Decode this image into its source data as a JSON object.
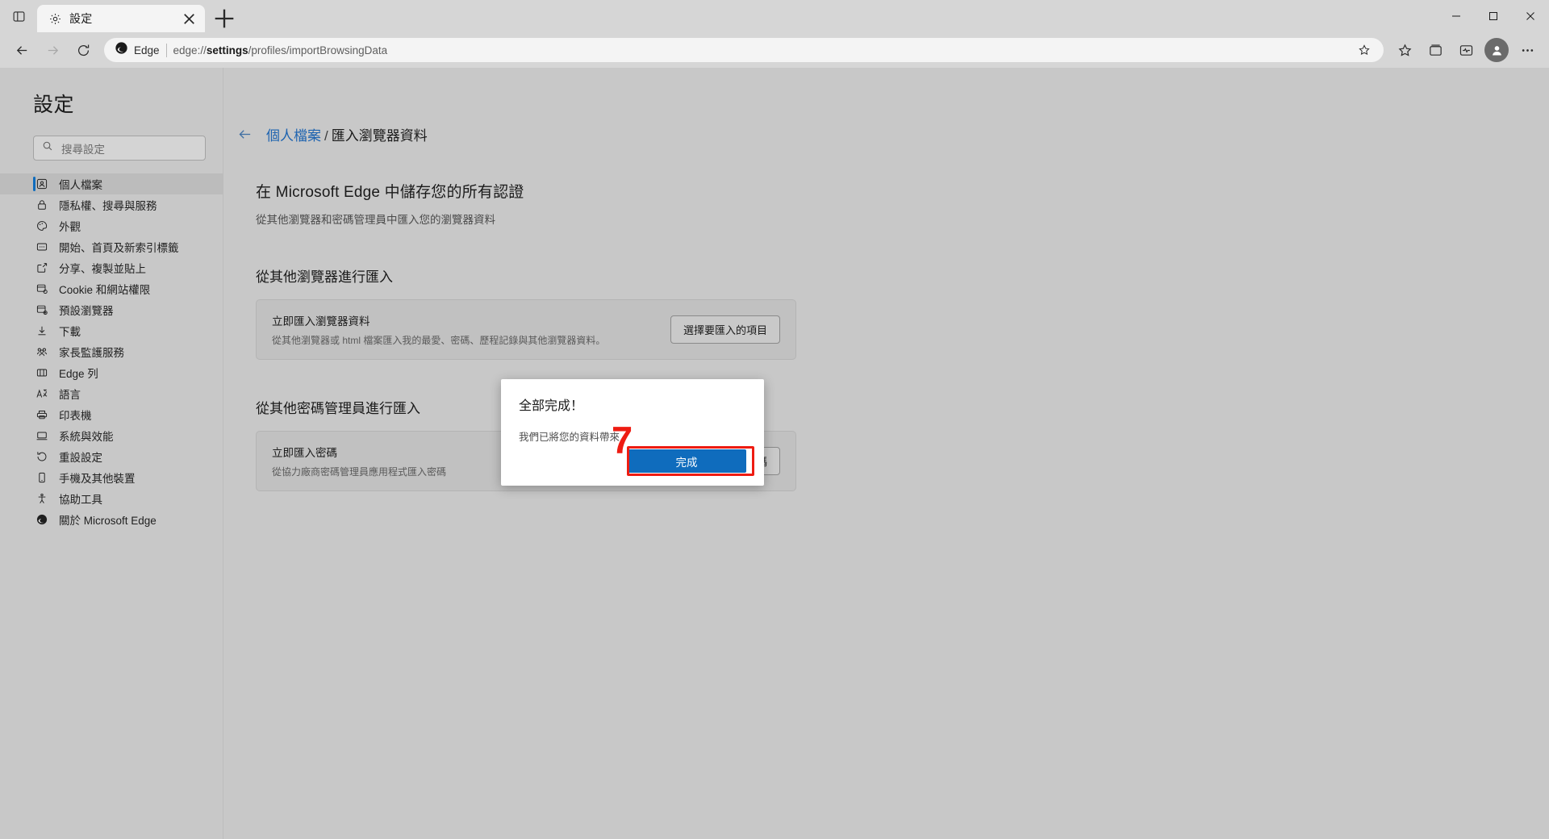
{
  "window": {
    "tab_title": "設定",
    "minimize_label": "最小化",
    "maximize_label": "最大化",
    "close_label": "關閉",
    "new_tab_label": "新索引標籤",
    "tab_actions_label": "索引標籤動作"
  },
  "toolbar": {
    "back_label": "上一頁",
    "forward_label": "下一頁",
    "refresh_label": "重新整理",
    "brand": "Edge",
    "url_prefix": "edge://",
    "url_bold": "settings",
    "url_suffix": "/profiles/importBrowsingData",
    "url_full": "edge://settings/profiles/importBrowsingData",
    "favorite_label": "新增至我的最愛",
    "favorites_label": "我的最愛",
    "collections_label": "集錦",
    "browser_essentials_label": "瀏覽器必備項目",
    "profile_label": "設定檔",
    "settings_more_label": "設定及其他"
  },
  "sidebar": {
    "title": "設定",
    "search_placeholder": "搜尋設定",
    "items": [
      {
        "label": "個人檔案",
        "icon": "profile-icon",
        "active": true
      },
      {
        "label": "隱私權、搜尋與服務",
        "icon": "lock-icon",
        "active": false
      },
      {
        "label": "外觀",
        "icon": "palette-icon",
        "active": false
      },
      {
        "label": "開始、首頁及新索引標籤",
        "icon": "home-icon",
        "active": false
      },
      {
        "label": "分享、複製並貼上",
        "icon": "share-icon",
        "active": false
      },
      {
        "label": "Cookie 和網站權限",
        "icon": "cookie-icon",
        "active": false
      },
      {
        "label": "預設瀏覽器",
        "icon": "default-browser-icon",
        "active": false
      },
      {
        "label": "下載",
        "icon": "download-icon",
        "active": false
      },
      {
        "label": "家長監護服務",
        "icon": "family-icon",
        "active": false
      },
      {
        "label": "Edge 列",
        "icon": "edge-bar-icon",
        "active": false
      },
      {
        "label": "語言",
        "icon": "language-icon",
        "active": false
      },
      {
        "label": "印表機",
        "icon": "printer-icon",
        "active": false
      },
      {
        "label": "系統與效能",
        "icon": "system-icon",
        "active": false
      },
      {
        "label": "重設設定",
        "icon": "reset-icon",
        "active": false
      },
      {
        "label": "手機及其他裝置",
        "icon": "phone-icon",
        "active": false
      },
      {
        "label": "協助工具",
        "icon": "accessibility-icon",
        "active": false
      },
      {
        "label": "關於 Microsoft Edge",
        "icon": "edge-logo-icon",
        "active": false
      }
    ]
  },
  "main": {
    "breadcrumb_parent": "個人檔案",
    "breadcrumb_separator": "/",
    "breadcrumb_current": "匯入瀏覽器資料",
    "heading": "在 Microsoft Edge 中儲存您的所有認證",
    "subheading": "從其他瀏覽器和密碼管理員中匯入您的瀏覽器資料",
    "section_browsers": {
      "heading": "從其他瀏覽器進行匯入",
      "card_title": "立即匯入瀏覽器資料",
      "card_desc": "從其他瀏覽器或 html 檔案匯入我的最愛、密碼、歷程記錄與其他瀏覽器資料。",
      "button": "選擇要匯入的項目"
    },
    "section_managers": {
      "heading": "從其他密碼管理員進行匯入",
      "card_title": "立即匯入密碼",
      "card_desc": "從協力廠商密碼管理員應用程式匯入密碼",
      "button": "選擇要匯入的密碼"
    }
  },
  "dialog": {
    "title": "全部完成！",
    "body": "我們已將您的資料帶來",
    "primary_button": "完成"
  },
  "annotation": {
    "step_number": "7",
    "highlight_color": "#ee1c12"
  },
  "colors": {
    "accent": "#0f6cbd",
    "link": "#1d63b0",
    "window_bg": "#c8c8c8",
    "toolbar_bg": "#d6d6d6",
    "card_bg": "#c1c1c1",
    "dialog_bg": "#ffffff"
  }
}
